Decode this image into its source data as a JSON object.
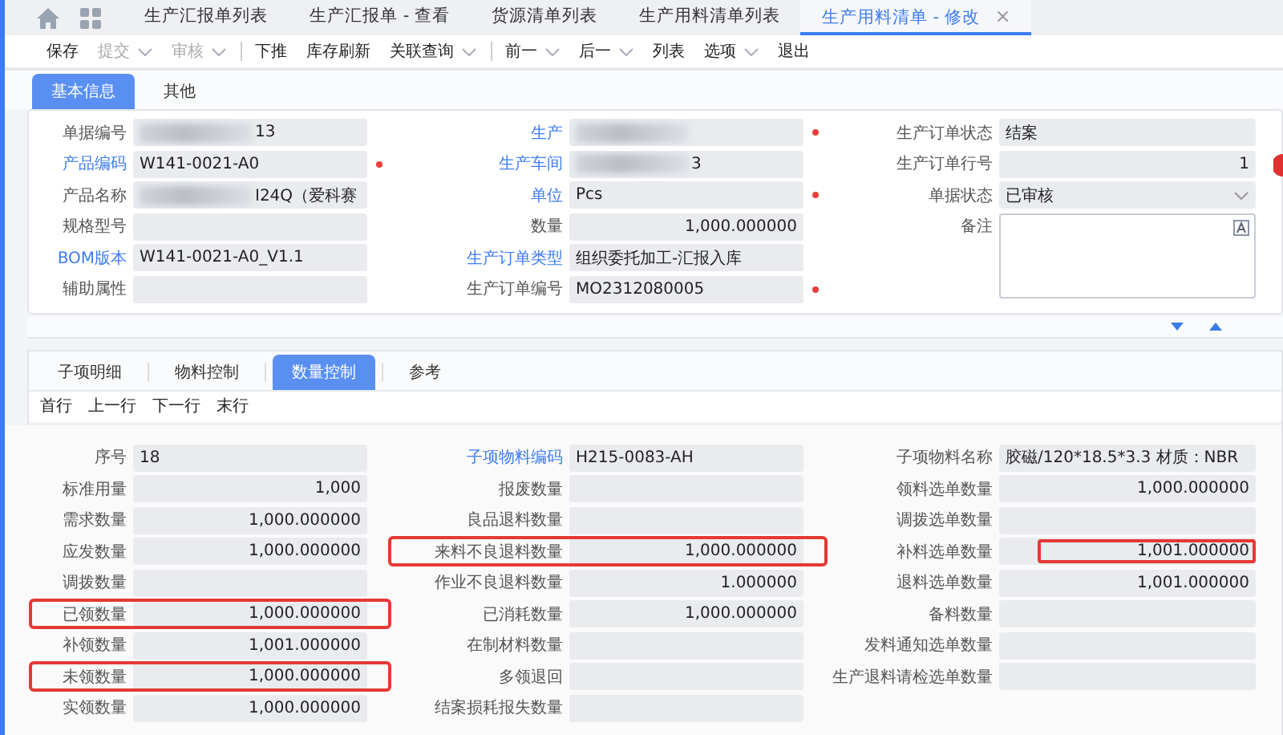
{
  "tabs": [
    {
      "label": "生产汇报单列表",
      "selected": false,
      "closable": false
    },
    {
      "label": "生产汇报单 - 查看",
      "selected": false,
      "closable": false
    },
    {
      "label": "货源清单列表",
      "selected": false,
      "closable": false
    },
    {
      "label": "生产用料清单列表",
      "selected": false,
      "closable": false
    },
    {
      "label": "生产用料清单 - 修改",
      "selected": true,
      "closable": true,
      "close_glyph": "×"
    }
  ],
  "toolbar": [
    {
      "label": "保存",
      "disabled": false,
      "dropdown": false,
      "divider_before": false
    },
    {
      "label": "提交",
      "disabled": true,
      "dropdown": true,
      "divider_before": false
    },
    {
      "label": "审核",
      "disabled": true,
      "dropdown": true,
      "divider_before": false
    },
    {
      "label": "下推",
      "disabled": false,
      "dropdown": false,
      "divider_before": true
    },
    {
      "label": "库存刷新",
      "disabled": false,
      "dropdown": false,
      "divider_before": false
    },
    {
      "label": "关联查询",
      "disabled": false,
      "dropdown": true,
      "divider_before": false
    },
    {
      "label": "前一",
      "disabled": false,
      "dropdown": true,
      "divider_before": true
    },
    {
      "label": "后一",
      "disabled": false,
      "dropdown": true,
      "divider_before": false
    },
    {
      "label": "列表",
      "disabled": false,
      "dropdown": false,
      "divider_before": false
    },
    {
      "label": "选项",
      "disabled": false,
      "dropdown": true,
      "divider_before": false
    },
    {
      "label": "退出",
      "disabled": false,
      "dropdown": false,
      "divider_before": false
    }
  ],
  "form_tabs": [
    {
      "label": "基本信息",
      "selected": true
    },
    {
      "label": "其他",
      "selected": false
    }
  ],
  "basic_columns": [
    [
      {
        "label": "单据编号",
        "link": false,
        "blurred": true,
        "value": "13"
      },
      {
        "label": "产品编码",
        "link": true,
        "required": true,
        "value": "W141-0021-A0"
      },
      {
        "label": "产品名称",
        "link": false,
        "blurred": true,
        "value": "I24Q（爱科赛"
      },
      {
        "label": "规格型号",
        "link": false
      },
      {
        "label": "BOM版本",
        "link": true,
        "value": "W141-0021-A0_V1.1"
      },
      {
        "label": "辅助属性",
        "link": false
      }
    ],
    [
      {
        "label": "生产",
        "link": true,
        "blurred": true,
        "required": true
      },
      {
        "label": "生产车间",
        "link": true,
        "blurred": true,
        "value": "3"
      },
      {
        "label": "单位",
        "link": true,
        "required": true,
        "value": "Pcs"
      },
      {
        "label": "数量",
        "link": false,
        "right_aligned": true,
        "value": "1,000.000000"
      },
      {
        "label": "生产订单类型",
        "link": true,
        "value": "组织委托加工-汇报入库"
      },
      {
        "label": "生产订单编号",
        "link": false,
        "required": true,
        "value": "MO2312080005"
      }
    ],
    [
      {
        "label": "生产订单状态",
        "link": false,
        "value": "结案"
      },
      {
        "label": "生产订单行号",
        "link": false,
        "right_aligned": true,
        "value": "1"
      },
      {
        "label": "单据状态",
        "link": false,
        "kind": "select",
        "value": "已审核"
      },
      {
        "label": "备注",
        "link": false,
        "kind": "textarea"
      }
    ]
  ],
  "sub_tabs": [
    {
      "label": "子项明细",
      "selected": false
    },
    {
      "label": "物料控制",
      "selected": false
    },
    {
      "label": "数量控制",
      "selected": true
    },
    {
      "label": "参考",
      "selected": false
    }
  ],
  "row_nav": [
    "首行",
    "上一行",
    "下一行",
    "末行"
  ],
  "detail_columns": [
    [
      {
        "label": "序号",
        "link": false,
        "value": "18"
      },
      {
        "label": "标准用量",
        "link": false,
        "right_aligned": true,
        "value": "1,000"
      },
      {
        "label": "需求数量",
        "link": false,
        "right_aligned": true,
        "value": "1,000.000000"
      },
      {
        "label": "应发数量",
        "link": false,
        "right_aligned": true,
        "value": "1,000.000000"
      },
      {
        "label": "调拨数量",
        "link": false
      },
      {
        "label": "已领数量",
        "link": false,
        "right_aligned": true,
        "value": "1,000.000000",
        "outlined_row": true
      },
      {
        "label": "补领数量",
        "link": false,
        "right_aligned": true,
        "value": "1,001.000000"
      },
      {
        "label": "未领数量",
        "link": false,
        "right_aligned": true,
        "value": "1,000.000000",
        "outlined_row": true
      },
      {
        "label": "实领数量",
        "link": false,
        "right_aligned": true,
        "value": "1,000.000000"
      }
    ],
    [
      {
        "label": "子项物料编码",
        "link": true,
        "value": "H215-0083-AH"
      },
      {
        "label": "报废数量",
        "link": false
      },
      {
        "label": "良品退料数量",
        "link": false
      },
      {
        "label": "来料不良退料数量",
        "link": false,
        "right_aligned": true,
        "value": "1,000.000000",
        "outlined_row": true
      },
      {
        "label": "作业不良退料数量",
        "link": false,
        "right_aligned": true,
        "value": "1.000000"
      },
      {
        "label": "已消耗数量",
        "link": false,
        "right_aligned": true,
        "value": "1,000.000000"
      },
      {
        "label": "在制材料数量",
        "link": false
      },
      {
        "label": "多领退回",
        "link": false
      },
      {
        "label": "结案损耗报失数量",
        "link": false
      }
    ],
    [
      {
        "label": "子项物料名称",
        "link": false,
        "value": "胶磁/120*18.5*3.3 材质：NBR"
      },
      {
        "label": "领料选单数量",
        "link": false,
        "right_aligned": true,
        "value": "1,000.000000"
      },
      {
        "label": "调拨选单数量",
        "link": false
      },
      {
        "label": "补料选单数量",
        "link": false,
        "right_aligned": true,
        "value": "1,001.000000",
        "outlined_value": true
      },
      {
        "label": "退料选单数量",
        "link": false,
        "right_aligned": true,
        "value": "1,001.000000"
      },
      {
        "label": "备料数量",
        "link": false
      },
      {
        "label": "发料通知选单数量",
        "link": false
      },
      {
        "label": "生产退料请检选单数量",
        "link": false
      }
    ]
  ]
}
